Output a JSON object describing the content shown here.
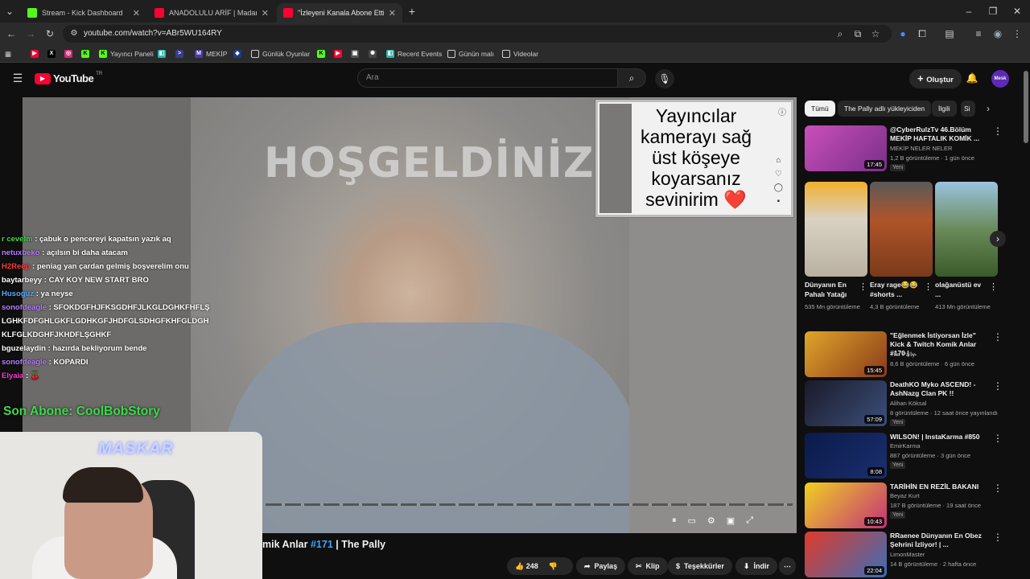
{
  "browser": {
    "tabs": [
      {
        "title": "Stream - Kick Dashboard",
        "color": "#53fc18",
        "active": false
      },
      {
        "title": "ANADOLULU ARİF | Madara Oluy...",
        "color": "#ff0033",
        "active": false
      },
      {
        "title": "\"İzleyeni Kanala Abone Ettiren...",
        "color": "#ff0033",
        "active": true
      }
    ],
    "url": "youtube.com/watch?v=ABr5WU164RY",
    "bookmarks": [
      "Yayıncı Paneli",
      "MEKİP",
      "Günlük Oyunlar",
      "Recent Events",
      "Günün malı",
      "Videolar"
    ]
  },
  "youtube": {
    "logo": "YouTube",
    "region": "TR",
    "search_placeholder": "Ara",
    "create_label": "Oluştur",
    "avatar_text": "Mesk"
  },
  "video": {
    "welcome_text": "HOŞGELDİNİZ",
    "notice_text": "Yayıncılar kamerayı sağ üst köşeye koyarsanız sevinirim",
    "notice_heart": "❤️",
    "title_prefix": "mik Anlar ",
    "title_tag": "#171",
    "title_suffix": " | The Pally",
    "actions": {
      "likes": "248",
      "share": "Paylaş",
      "clip": "Klip",
      "thanks": "Teşekkürler",
      "download": "İndir"
    }
  },
  "overlay": {
    "chat": [
      {
        "user": "r cevelm",
        "color": "#3dd94a",
        "text": ": çabuk o pencereyi kapatsın yazık aq"
      },
      {
        "user": "netuxbeko",
        "color": "#b77cff",
        "text": ": açılsın bi daha atacam"
      },
      {
        "user": "H2Reep",
        "color": "#ff3b3b",
        "text": ": peniag yan çardan gelmiş boşverelim onu"
      },
      {
        "user": "baytarbeyy",
        "color": "#ffffff",
        "text": ": CAY KOY NEW START BRO"
      },
      {
        "user": "Husoguz",
        "color": "#5aa7ff",
        "text": ": ya neyse"
      },
      {
        "user": "sonofdeagle",
        "color": "#b77cff",
        "text": ": SFOKDGFHJFKSGDHFJLKGLDGHKFHFLŞLGHKFDFGHLGKFLGDHKGFJHDFGLSDHGFKHFGLDGHKLFGLKDGHFJKHDFLŞGHKF"
      },
      {
        "user": "bguzelaydin",
        "color": "#ffffff",
        "text": ": hazırda bekliyorum bende"
      },
      {
        "user": "sonofdeagle",
        "color": "#b77cff",
        "text": ": KOPARDI"
      },
      {
        "user": "Elyaia",
        "color": "#ff3bd9",
        "text": ": 🍒"
      }
    ],
    "last_subscriber": "Son Abone: CoolBobStory",
    "cam_label": "MASKAR"
  },
  "sidebar": {
    "chips": [
      "Tümü",
      "The Pally adlı yükleyiciden",
      "İlgili",
      "Si"
    ],
    "videos": [
      {
        "title": "@CyberRulzTv 46.Bölüm MEKİP HAFTALIK KOMİK ...",
        "channel": "MEKİP NELER NELER",
        "meta": "1,2 B görüntüleme · 1 gün önce",
        "duration": "17:45",
        "badge": "Yeni",
        "thumb": "#c94fb9"
      },
      {
        "title": "\"Eğlenmek İstiyorsan İzle\" Kick & Twitch Komik Anlar #170 | ...",
        "channel": "The Pally",
        "meta": "8,6 B görüntüleme · 6 gün önce",
        "duration": "15:45",
        "badge": "",
        "thumb": "#e0a52a"
      },
      {
        "title": "DeathKO Myko ASCEND! - AshNazg Clan PK !!",
        "channel": "Alihan Köksal",
        "meta": "8 görüntüleme · 12 saat önce yayınlandı",
        "duration": "57:09",
        "badge": "Yeni",
        "thumb": "#3c4f7a"
      },
      {
        "title": "WILSON! | InstaKarma #850",
        "channel": "EmirKarma",
        "meta": "887 görüntüleme · 3 gün önce",
        "duration": "8:08",
        "badge": "Yeni",
        "thumb": "#1c2f6e"
      },
      {
        "title": "TARİHİN EN REZİL BAKANI",
        "channel": "Beyaz Kurt",
        "meta": "187 B görüntüleme · 19 saat önce",
        "duration": "10:43",
        "badge": "Yeni",
        "thumb": "#c4327a"
      },
      {
        "title": "RRaenee Dünyanın En Obez Şehrini İzliyor! | ...",
        "channel": "LimonMaster",
        "meta": "14 B görüntüleme · 2 hafta önce",
        "duration": "22:04",
        "badge": "",
        "thumb": "#3a6fb8"
      }
    ],
    "shorts": [
      {
        "title": "Dünyanın En Pahalı Yatağı",
        "views": "535 Mn görüntüleme",
        "thumb": "#d9d2c4"
      },
      {
        "title": "Eray rage😂😂 #shorts ...",
        "views": "4,3 B görüntüleme",
        "thumb": "#b0542a"
      },
      {
        "title": "olağanüstü ev ...",
        "views": "413 Mn görüntüleme",
        "thumb": "#6a8a5a"
      }
    ]
  }
}
